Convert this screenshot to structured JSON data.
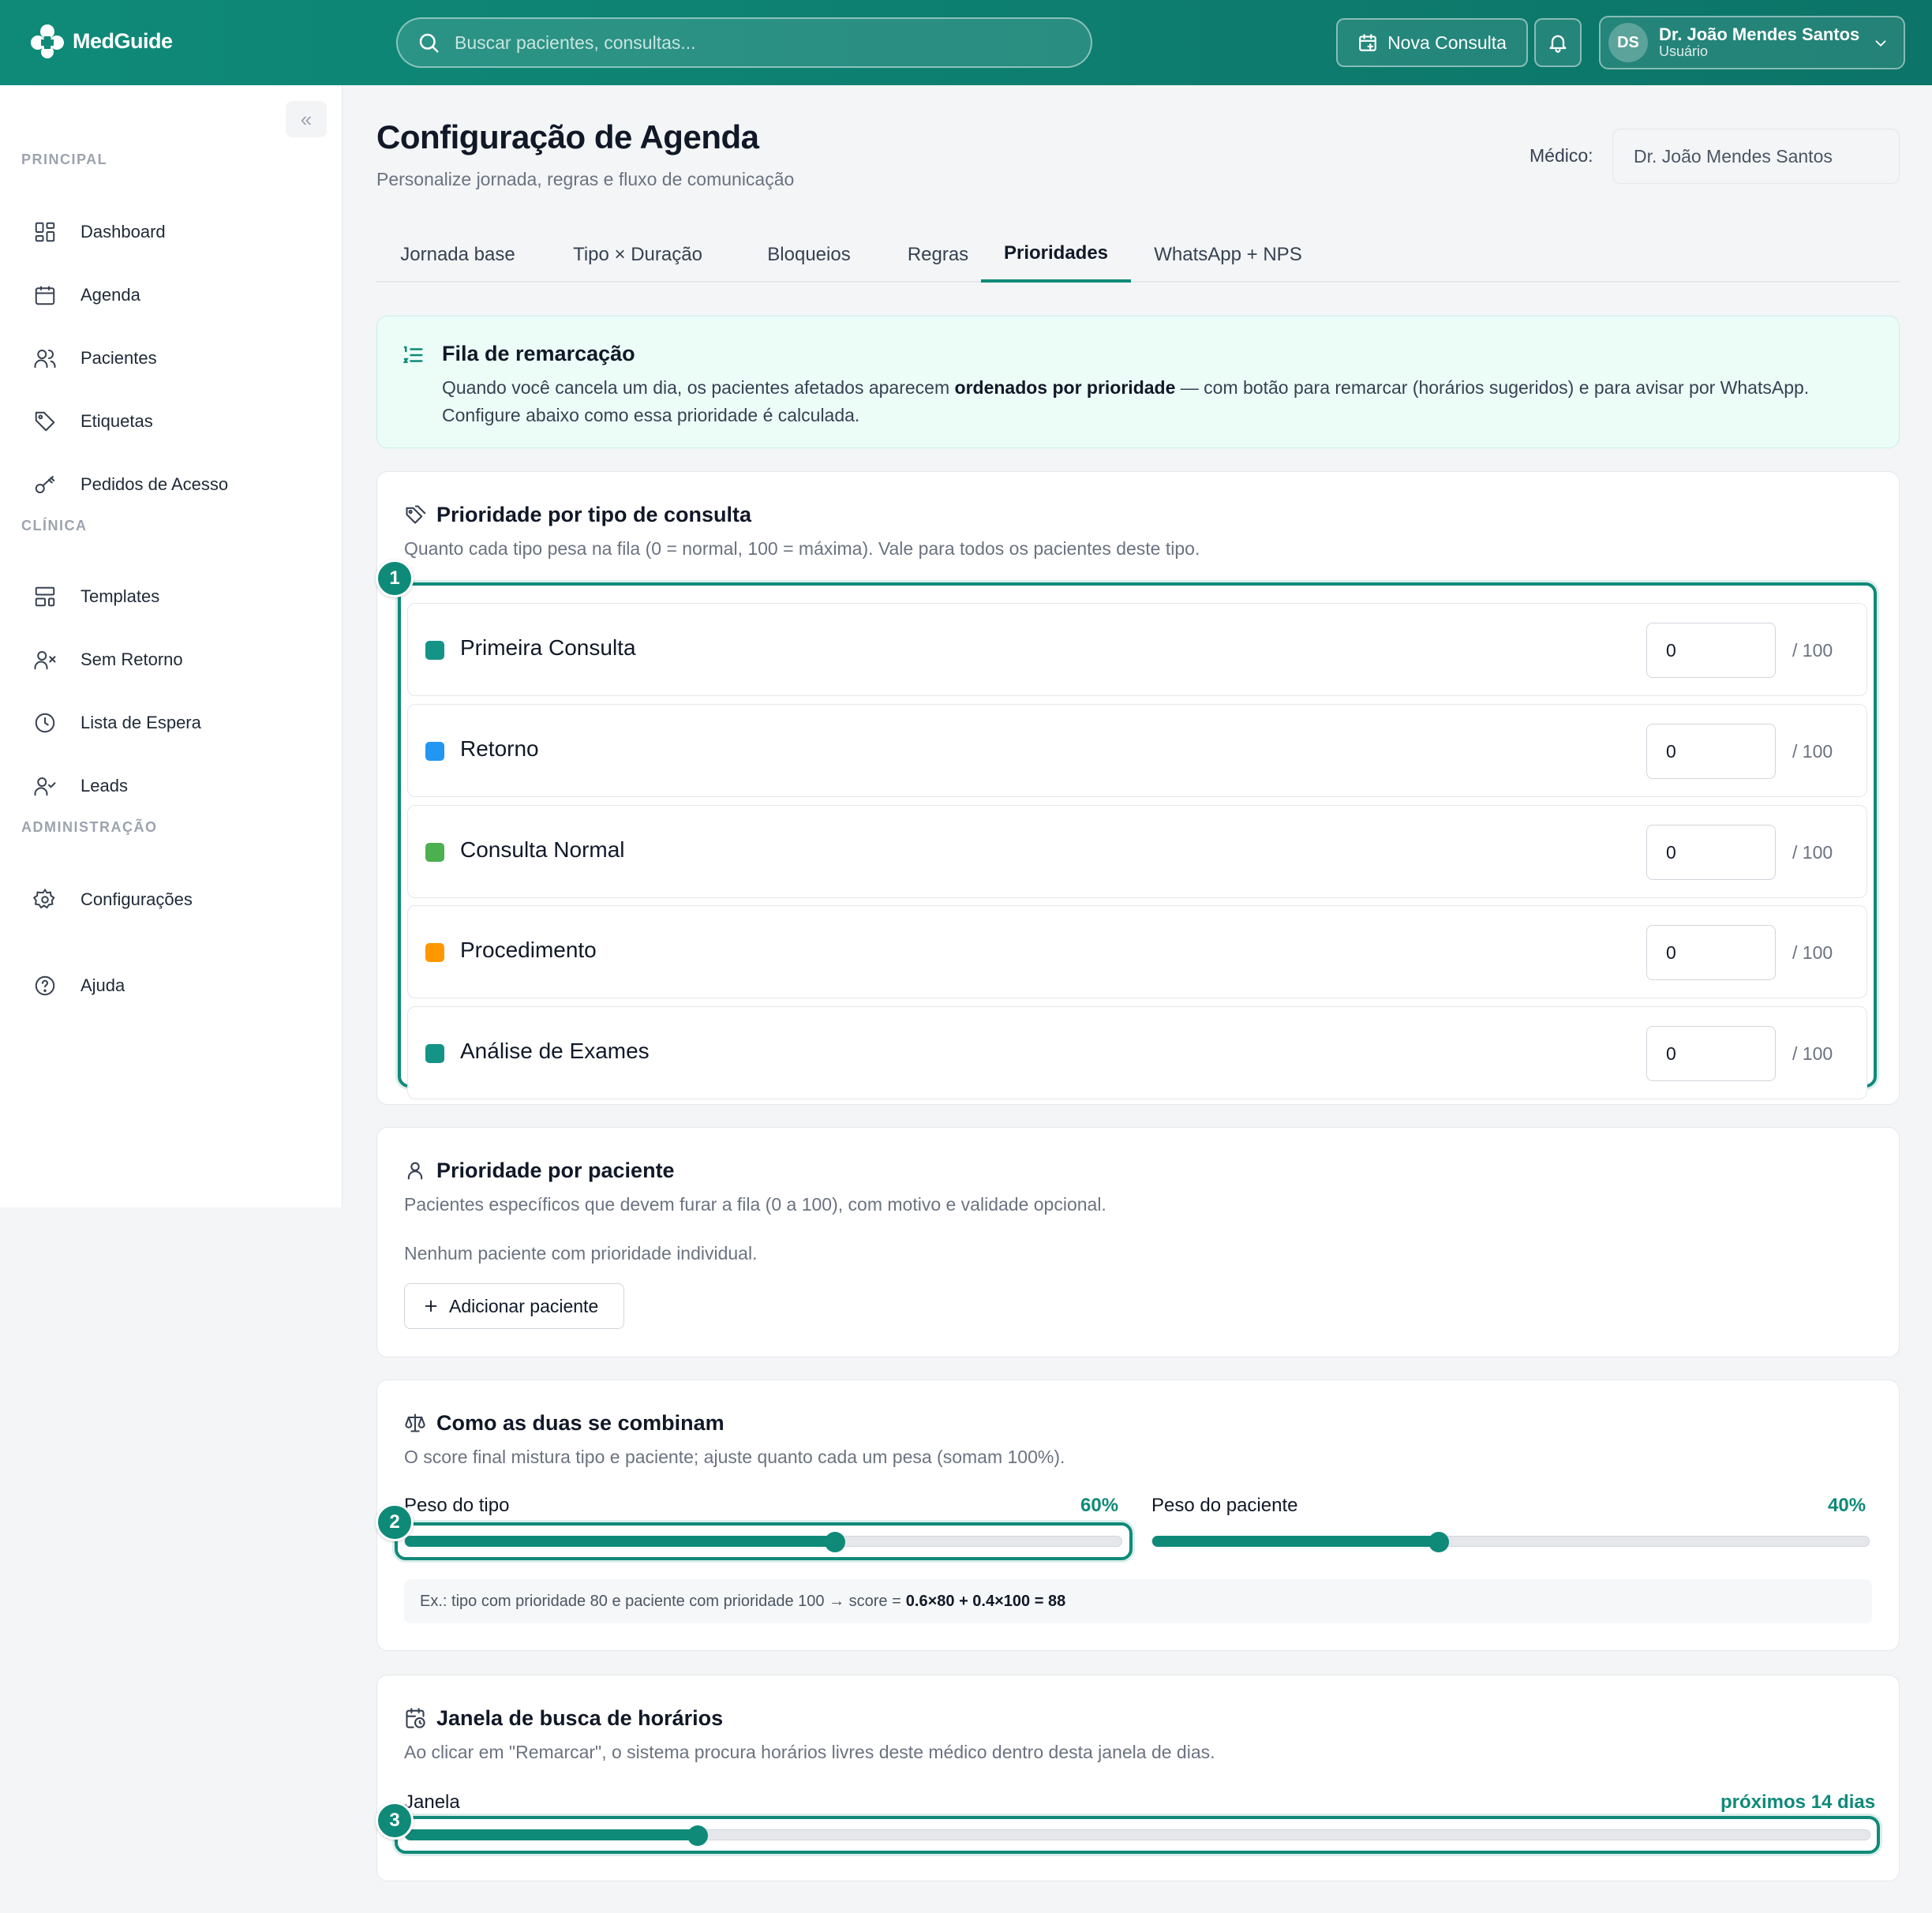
{
  "app": {
    "name": "MedGuide"
  },
  "header": {
    "search_placeholder": "Buscar pacientes, consultas...",
    "new_consult_label": "Nova Consulta",
    "user": {
      "initials": "DS",
      "name": "Dr. João Mendes Santos",
      "role": "Usuário"
    }
  },
  "sidebar": {
    "collapse_label": "«",
    "sections": [
      {
        "title": "PRINCIPAL",
        "items": [
          "Dashboard",
          "Agenda",
          "Pacientes",
          "Etiquetas",
          "Pedidos de Acesso"
        ]
      },
      {
        "title": "CLÍNICA",
        "items": [
          "Templates",
          "Sem Retorno",
          "Lista de Espera",
          "Leads"
        ]
      },
      {
        "title": "ADMINISTRAÇÃO",
        "items": [
          "Configurações"
        ]
      }
    ],
    "help_label": "Ajuda"
  },
  "page": {
    "title": "Configuração de Agenda",
    "subtitle": "Personalize jornada, regras e fluxo de comunicação",
    "doctor_label": "Médico:",
    "doctor_value": "Dr. João Mendes Santos",
    "tabs": [
      "Jornada base",
      "Tipo × Duração",
      "Bloqueios",
      "Regras",
      "Prioridades",
      "WhatsApp + NPS"
    ],
    "active_tab": "Prioridades"
  },
  "info": {
    "title": "Fila de remarcação",
    "text_before": "Quando você cancela um dia, os pacientes afetados aparecem ",
    "text_bold": "ordenados por prioridade",
    "text_after": " — com botão para remarcar (horários sugeridos) e para avisar por WhatsApp. Configure abaixo como essa prioridade é calculada."
  },
  "type_priority": {
    "title": "Prioridade por tipo de consulta",
    "subtitle": "Quanto cada tipo pesa na fila (0 = normal, 100 = máxima). Vale para todos os pacientes deste tipo.",
    "max_label": "/ 100",
    "badge": "1",
    "items": [
      {
        "name": "Primeira Consulta",
        "value": "0",
        "color": "#139486"
      },
      {
        "name": "Retorno",
        "value": "0",
        "color": "#2196f3"
      },
      {
        "name": "Consulta Normal",
        "value": "0",
        "color": "#4caf50"
      },
      {
        "name": "Procedimento",
        "value": "0",
        "color": "#ff9800"
      },
      {
        "name": "Análise de Exames",
        "value": "0",
        "color": "#139486"
      }
    ]
  },
  "patient_priority": {
    "title": "Prioridade por paciente",
    "subtitle": "Pacientes específicos que devem furar a fila (0 a 100), com motivo e validade opcional.",
    "empty": "Nenhum paciente com prioridade individual.",
    "add_label": "Adicionar paciente"
  },
  "combine": {
    "title": "Como as duas se combinam",
    "subtitle": "O score final mistura tipo e paciente; ajuste quanto cada um pesa (somam 100%).",
    "badge": "2",
    "type_weight": {
      "label": "Peso do tipo",
      "display": "60%",
      "value": 0.6
    },
    "patient_weight": {
      "label": "Peso do paciente",
      "display": "40%",
      "value": 0.4
    },
    "example_text": "Ex.: tipo com prioridade 80 e paciente com prioridade 100 → score =",
    "example_formula": "0.6×80 + 0.4×100 = 88"
  },
  "window": {
    "title": "Janela de busca de horários",
    "subtitle": "Ao clicar em \"Remarcar\", o sistema procura horários livres deste médico dentro desta janela de dias.",
    "badge": "3",
    "label": "Janela",
    "display": "próximos 14 dias",
    "value": 0.2
  },
  "colors": {
    "brand": "#0f8a79",
    "accent_bg": "#ecfdf8"
  }
}
